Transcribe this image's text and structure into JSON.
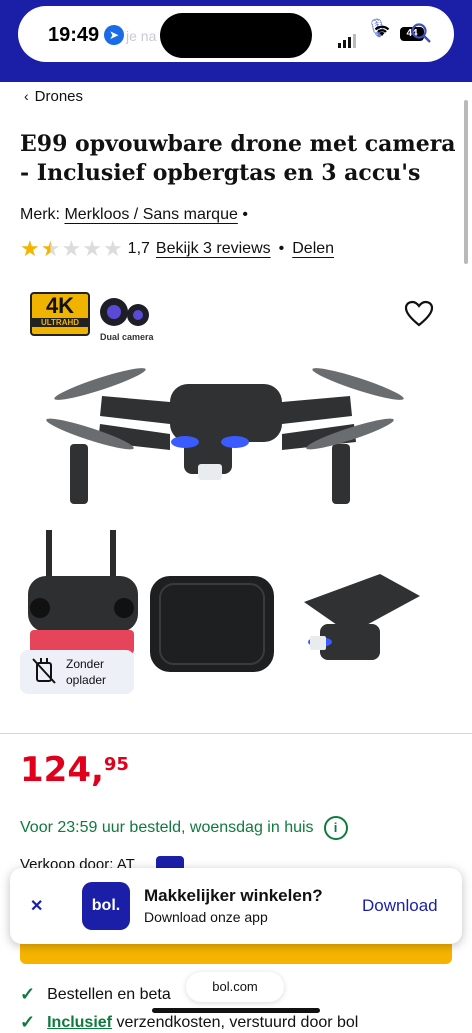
{
  "status_bar": {
    "time": "19:49",
    "battery": "44",
    "url_ghost": "je na"
  },
  "breadcrumb": {
    "label": "Drones"
  },
  "product": {
    "title": "E99 opvouwbare drone met camera - Inclusief opbergtas en 3 accu's",
    "brand_prefix": "Merk:",
    "brand": "Merkloos / Sans marque",
    "rating_value": "1,7",
    "rating_stars": 1.7,
    "reviews_link": "Bekijk 3 reviews",
    "share_link": "Delen",
    "image_badges": {
      "resolution_big": "4K",
      "resolution_small": "ULTRAHD",
      "camera_label": "Dual camera"
    },
    "no_charger": {
      "line1": "Zonder",
      "line2": "oplader"
    },
    "price": {
      "euros": "124,",
      "cents": "95"
    },
    "delivery": "Voor 23:59 uur besteld, woensdag in huis",
    "partial_row": "Verkoop door: AT"
  },
  "app_banner": {
    "logo": "bol.",
    "title": "Makkelijker winkelen?",
    "subtitle": "Download onze app",
    "download": "Download"
  },
  "usps": [
    {
      "text": "Bestellen en beta"
    },
    {
      "text_bold": "Inclusief",
      "text": " verzendkosten, verstuurd door bol"
    }
  ],
  "browser": {
    "domain": "bol.com"
  },
  "colors": {
    "brand_blue": "#1b1fa8",
    "price_red": "#e0001b",
    "delivery_green": "#0e7a3d",
    "star": "#f6b400"
  }
}
